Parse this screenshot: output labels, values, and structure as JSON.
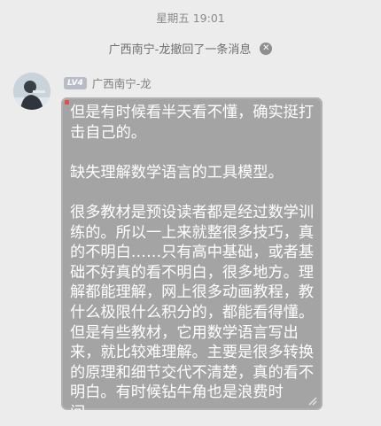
{
  "header": {
    "timestamp": "星期五 19:01"
  },
  "recall": {
    "text": "广西南宁-龙撤回了一条消息",
    "close_symbol": "✕"
  },
  "sender": {
    "level": "LV4",
    "name": "广西南宁-龙"
  },
  "message": {
    "paragraphs": [
      "但是有时候看半天看不懂，确实挺打击自己的。",
      "缺失理解数学语言的工具模型。",
      "很多教材是预设读者都是经过数学训练的。所以一上来就整很多技巧，真的不明白……只有高中基础，或者基础不好真的看不明白，很多地方。理解都能理解，网上很多动画教程，教什么极限什么积分的，都能看得懂。但是有些教材，它用数学语言写出来，就比较难理解。主要是很多转换的原理和细节交代不清楚，真的看不明白。有时候钻牛角也是浪费时间……"
    ]
  },
  "colors": {
    "background": "#ececec",
    "bubble": "#a4a4a4",
    "bubble_text": "#ffffff",
    "meta_text": "#8a8a8a"
  }
}
